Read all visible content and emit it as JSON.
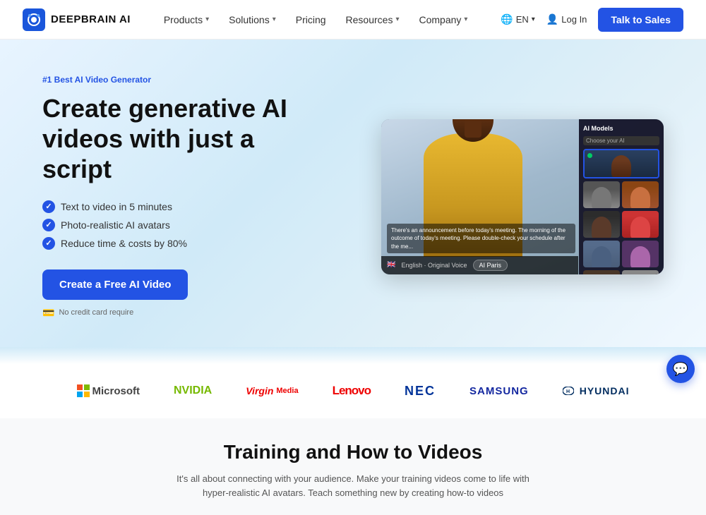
{
  "brand": {
    "name": "DEEPBRAIN AI",
    "logo_text": "DEEPBRAIN AI"
  },
  "nav": {
    "links": [
      {
        "label": "Products",
        "has_dropdown": true
      },
      {
        "label": "Solutions",
        "has_dropdown": true
      },
      {
        "label": "Pricing",
        "has_dropdown": false
      },
      {
        "label": "Resources",
        "has_dropdown": true
      },
      {
        "label": "Company",
        "has_dropdown": true
      }
    ],
    "lang_label": "EN",
    "login_label": "Log In",
    "cta_label": "Talk to Sales"
  },
  "hero": {
    "badge": "#1 Best AI Video Generator",
    "title": "Create generative AI videos with just a script",
    "features": [
      "Text to video in 5 minutes",
      "Photo-realistic AI avatars",
      "Reduce time & costs by 80%"
    ],
    "cta_label": "Create a Free AI Video",
    "no_credit_text": "No credit card require"
  },
  "video_panel": {
    "models_title": "AI Models",
    "subtitle_text": "There's an announcement before today's meeting. The morning of the outcome of today's meeting. Please double-check your schedule after the me...",
    "bottom_lang": "English · Original Voice",
    "avatar_label": "AI Paris"
  },
  "partners": [
    {
      "label": "Microsoft",
      "type": "microsoft"
    },
    {
      "label": "NVIDIA",
      "type": "nvidia"
    },
    {
      "label": "Virgin",
      "type": "virgin"
    },
    {
      "label": "Lenovo",
      "type": "lenovo"
    },
    {
      "label": "NEC",
      "type": "nec"
    },
    {
      "label": "SAMSUNG",
      "type": "samsung"
    },
    {
      "label": "HYUNDAI",
      "type": "hyundai"
    }
  ],
  "training_section": {
    "title": "Training and How to Videos",
    "description": "It's all about connecting with your audience. Make your training videos come to life with hyper-realistic AI avatars. Teach something new by creating how-to videos"
  }
}
